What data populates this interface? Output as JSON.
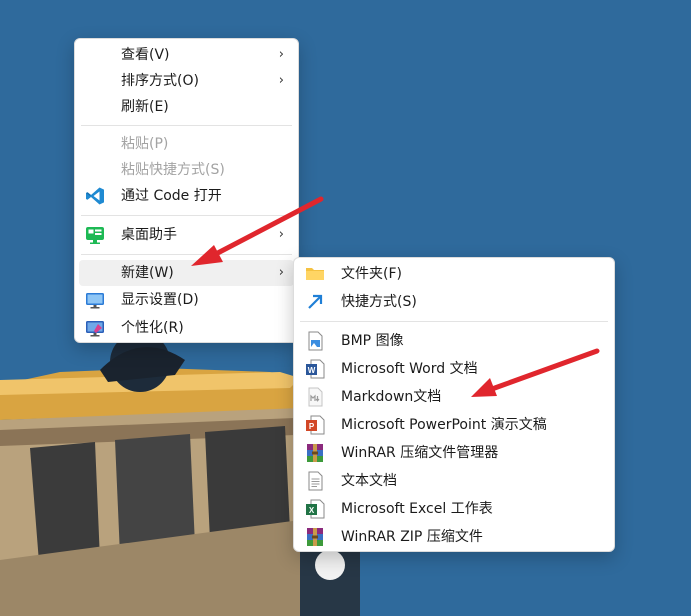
{
  "desktop_menu": {
    "items": [
      {
        "label": "查看(V)"
      },
      {
        "label": "排序方式(O)"
      },
      {
        "label": "刷新(E)"
      },
      {
        "label": "粘贴(P)"
      },
      {
        "label": "粘贴快捷方式(S)"
      },
      {
        "label": "通过 Code 打开"
      },
      {
        "label": "桌面助手"
      },
      {
        "label": "新建(W)"
      },
      {
        "label": "显示设置(D)"
      },
      {
        "label": "个性化(R)"
      }
    ]
  },
  "new_submenu": {
    "items": [
      {
        "label": "文件夹(F)"
      },
      {
        "label": "快捷方式(S)"
      },
      {
        "label": "BMP 图像"
      },
      {
        "label": "Microsoft Word 文档"
      },
      {
        "label": "Markdown文档"
      },
      {
        "label": "Microsoft PowerPoint 演示文稿"
      },
      {
        "label": "WinRAR 压缩文件管理器"
      },
      {
        "label": "文本文档"
      },
      {
        "label": "Microsoft Excel 工作表"
      },
      {
        "label": "WinRAR ZIP 压缩文件"
      }
    ]
  },
  "colors": {
    "desktop": "#2f6a9c",
    "arrow": "#e0262d",
    "menu_bg": "#ffffff",
    "hover": "#f0f0f0"
  }
}
